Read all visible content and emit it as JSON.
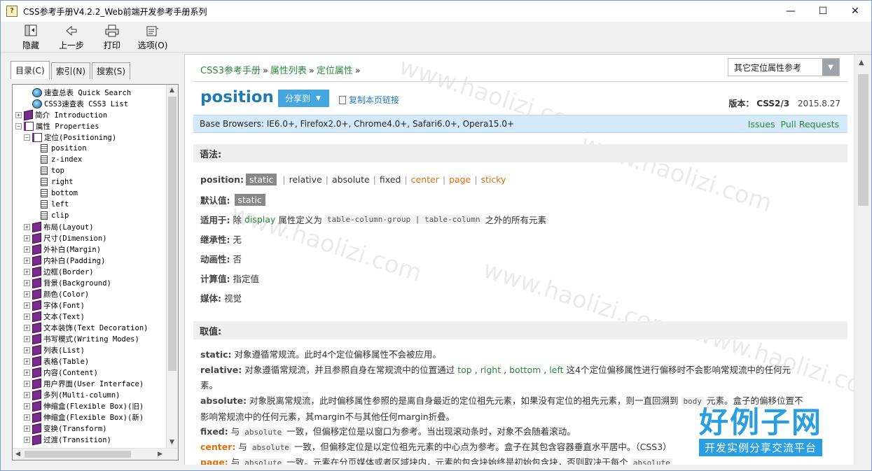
{
  "window": {
    "title": "CSS参考手册V4.2.2_Web前端开发参考手册系列",
    "app_icon": "?",
    "controls": {
      "minimize": "—",
      "maximize": "☐",
      "close": "✕"
    }
  },
  "toolbar": {
    "hide": "隐藏",
    "back": "上一步",
    "print": "打印",
    "options": "选项(O)"
  },
  "tabs": {
    "contents": "目录(C)",
    "index": "索引(N)",
    "search": "搜索(S)"
  },
  "tree": [
    {
      "label": "速查总表 Quick Search",
      "icon": "globe-icon",
      "level": 1,
      "expander": ""
    },
    {
      "label": "CSS3速查表 CSS3 List",
      "icon": "globe-icon",
      "level": 1,
      "expander": ""
    },
    {
      "label": "简介 Introduction",
      "icon": "book-icon",
      "level": 0,
      "expander": "+"
    },
    {
      "label": "属性 Properties",
      "icon": "open-book-icon",
      "level": 0,
      "expander": "−"
    },
    {
      "label": "定位(Positioning)",
      "icon": "open-book-icon",
      "level": 1,
      "expander": "−"
    },
    {
      "label": "position",
      "icon": "page-icon",
      "level": 3,
      "expander": ""
    },
    {
      "label": "z-index",
      "icon": "page-icon",
      "level": 3,
      "expander": ""
    },
    {
      "label": "top",
      "icon": "page-icon",
      "level": 3,
      "expander": ""
    },
    {
      "label": "right",
      "icon": "page-icon",
      "level": 3,
      "expander": ""
    },
    {
      "label": "bottom",
      "icon": "page-icon",
      "level": 3,
      "expander": ""
    },
    {
      "label": "left",
      "icon": "page-icon",
      "level": 3,
      "expander": ""
    },
    {
      "label": "clip",
      "icon": "page-icon",
      "level": 3,
      "expander": ""
    },
    {
      "label": "布局(Layout)",
      "icon": "book-icon",
      "level": 1,
      "expander": "+"
    },
    {
      "label": "尺寸(Dimension)",
      "icon": "book-icon",
      "level": 1,
      "expander": "+"
    },
    {
      "label": "外补白(Margin)",
      "icon": "book-icon",
      "level": 1,
      "expander": "+"
    },
    {
      "label": "内补白(Padding)",
      "icon": "book-icon",
      "level": 1,
      "expander": "+"
    },
    {
      "label": "边框(Border)",
      "icon": "book-icon",
      "level": 1,
      "expander": "+"
    },
    {
      "label": "背景(Background)",
      "icon": "book-icon",
      "level": 1,
      "expander": "+"
    },
    {
      "label": "颜色(Color)",
      "icon": "book-icon",
      "level": 1,
      "expander": "+"
    },
    {
      "label": "字体(Font)",
      "icon": "book-icon",
      "level": 1,
      "expander": "+"
    },
    {
      "label": "文本(Text)",
      "icon": "book-icon",
      "level": 1,
      "expander": "+"
    },
    {
      "label": "文本装饰(Text Decoration)",
      "icon": "book-icon",
      "level": 1,
      "expander": "+"
    },
    {
      "label": "书写模式(Writing Modes)",
      "icon": "book-icon",
      "level": 1,
      "expander": "+"
    },
    {
      "label": "列表(List)",
      "icon": "book-icon",
      "level": 1,
      "expander": "+"
    },
    {
      "label": "表格(Table)",
      "icon": "book-icon",
      "level": 1,
      "expander": "+"
    },
    {
      "label": "内容(Content)",
      "icon": "book-icon",
      "level": 1,
      "expander": "+"
    },
    {
      "label": "用户界面(User Interface)",
      "icon": "book-icon",
      "level": 1,
      "expander": "+"
    },
    {
      "label": "多列(Multi-column)",
      "icon": "book-icon",
      "level": 1,
      "expander": "+"
    },
    {
      "label": "伸缩盒(Flexible Box)(旧)",
      "icon": "book-icon",
      "level": 1,
      "expander": "+"
    },
    {
      "label": "伸缩盒(Flexible Box)(新)",
      "icon": "book-icon",
      "level": 1,
      "expander": "+"
    },
    {
      "label": "变换(Transform)",
      "icon": "book-icon",
      "level": 1,
      "expander": "+"
    },
    {
      "label": "过渡(Transition)",
      "icon": "book-icon",
      "level": 1,
      "expander": "+"
    }
  ],
  "breadcrumb": {
    "items": [
      "CSS3参考手册",
      "属性列表",
      "定位属性"
    ],
    "sep": "»"
  },
  "related_select": {
    "value": "其它定位属性参考",
    "arrow": "▼"
  },
  "page": {
    "title": "position",
    "share": "分享到",
    "copy_link": "复制本页链接",
    "version_label": "版本：",
    "version_value": "CSS2/3",
    "date": "2015.8.27"
  },
  "base_browsers": {
    "text": "Base Browsers: IE6.0+, Firefox2.0+, Chrome4.0+, Safari6.0+, Opera15.0+",
    "issues": "Issues",
    "pull_requests": "Pull Requests"
  },
  "syntax": {
    "heading": "语法:",
    "position_label": "position:",
    "values": [
      "static",
      "relative",
      "absolute",
      "fixed",
      "center",
      "page",
      "sticky"
    ],
    "default_label": "默认值:",
    "default_value": "static",
    "applies_label": "适用于:",
    "applies_pre": "除",
    "applies_link": "display",
    "applies_mid": "属性定义为",
    "applies_code": "table-column-group | table-column",
    "applies_post": "之外的所有元素",
    "inherit_label": "继承性:",
    "inherit_value": "无",
    "anim_label": "动画性:",
    "anim_value": "否",
    "computed_label": "计算值:",
    "computed_value": "指定值",
    "media_label": "媒体:",
    "media_value": "视觉"
  },
  "values_section": {
    "heading": "取值:",
    "static_k": "static:",
    "static_t": "对象遵循常规流。此时4个定位偏移属性不会被应用。",
    "relative_k": "relative:",
    "relative_t1": "对象遵循常规流，并且参照自身在常规流中的位置通过",
    "relative_links": [
      "top",
      "right",
      "bottom",
      "left"
    ],
    "relative_t2": "这4个定位偏移属性进行偏移时不会影响常规流中的任何元",
    "relative_t3": "素。",
    "absolute_k": "absolute:",
    "absolute_t1": "对象脱离常规流，此时偏移属性参照的是离自身最近的定位祖先元素，如果没有定位的祖先元素，则一直回溯到",
    "absolute_code": "body",
    "absolute_t2": "元素。盒子的偏移位置不",
    "absolute_t3": "影响常规流中的任何元素，其margin不与其他任何margin折叠。",
    "fixed_k": "fixed:",
    "fixed_pre": "与",
    "fixed_code": "absolute",
    "fixed_t": "一致，但偏移定位是以窗口为参考。当出现滚动条时，对象不会随着滚动。",
    "center_k": "center:",
    "center_pre": "与",
    "center_code": "absolute",
    "center_t": "一致，但偏移定位是以定位祖先元素的中心点为参考。盒子在其包含容器垂直水平居中。（CSS3）",
    "page_k": "page:",
    "page_pre": "与",
    "page_code": "absolute",
    "page_t": "一致。元素在分页媒体或者区域块内，元素的包含块始终是初始包含块，否则取决于每个",
    "page_code2": "absolute"
  },
  "watermark": {
    "text": "www.haolizi.com",
    "brand": "好例子网",
    "slogan": "开发实例分享交流平台"
  }
}
